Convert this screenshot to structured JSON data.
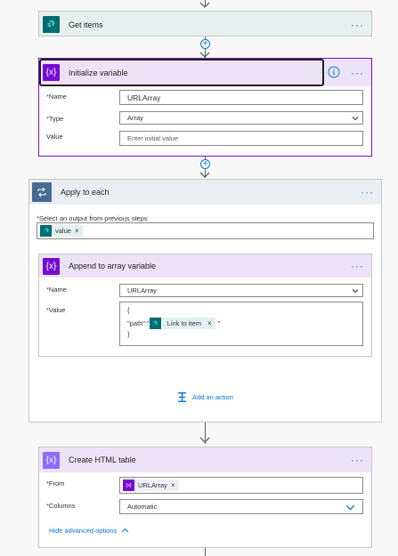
{
  "colors": {
    "sharepoint": "#036c70",
    "variable": "#770bd6",
    "loop": "#486991",
    "accent": "#0078d4"
  },
  "get_items": {
    "title": "Get items",
    "icon": "sharepoint-icon",
    "more": "···"
  },
  "init_var": {
    "title": "Initialize variable",
    "icon_text": "{x}",
    "more": "···",
    "name_label": "Name",
    "name_value": "URLArray",
    "type_label": "Type",
    "type_value": "Array",
    "value_label": "Value",
    "value_placeholder": "Enter initial value"
  },
  "apply_each": {
    "title": "Apply to each",
    "more": "···",
    "select_label": "Select an output from previous steps",
    "token_label": "value",
    "token_x": "×",
    "add_action": "Add an action"
  },
  "append_var": {
    "title": "Append to array variable",
    "icon_text": "{x}",
    "more": "···",
    "name_label": "Name",
    "name_value": "URLArray",
    "value_label": "Value",
    "line1": "{",
    "path_text": "\"path\":\"",
    "token_label": "Link to item",
    "token_x": "×",
    "after_token": "\"",
    "line3": "}"
  },
  "html_table": {
    "title": "Create HTML table",
    "icon_text": "{x}",
    "more": "···",
    "from_label": "From",
    "from_token": "URLArray",
    "from_token_x": "×",
    "columns_label": "Columns",
    "columns_value": "Automatic",
    "hide_advanced": "Hide advanced options"
  },
  "required_mark": "*",
  "add_step_symbol": "+"
}
